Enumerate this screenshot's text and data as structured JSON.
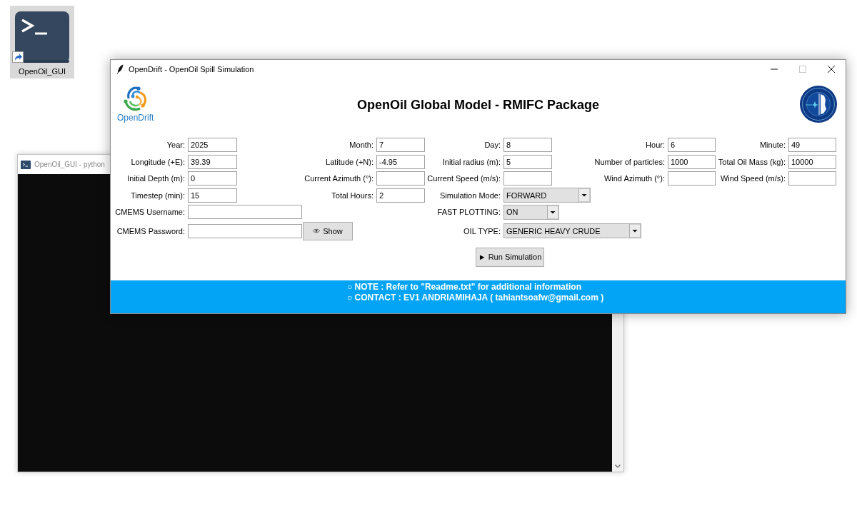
{
  "desktop": {
    "icons": [
      {
        "label": "OpenOil_GUI",
        "selected": true
      }
    ]
  },
  "console_window": {
    "title": "OpenOil_GUI - python",
    "active": false
  },
  "main_window": {
    "title": "OpenDrift - OpenOil Spill Simulation",
    "active": true,
    "controls": [
      {
        "kind": "minimize",
        "disabled": false
      },
      {
        "kind": "maximize",
        "disabled": true
      },
      {
        "kind": "close",
        "disabled": false
      }
    ],
    "header": {
      "logo_text": "OpenDrift",
      "heading": "OpenOil Global Model - RMIFC Package"
    },
    "form": {
      "rows": [
        {
          "fields": [
            {
              "kind": "entry",
              "label": "Year:",
              "value": "2025"
            },
            {
              "kind": "entry",
              "label": "Month:",
              "value": "7"
            },
            {
              "kind": "entry",
              "label": "Day:",
              "value": "8"
            },
            {
              "kind": "entry",
              "label": "Hour:",
              "value": "6"
            },
            {
              "kind": "entry",
              "label": "Minute:",
              "value": "49"
            }
          ]
        },
        {
          "fields": [
            {
              "kind": "entry",
              "label": "Longitude (+E):",
              "value": "39.39"
            },
            {
              "kind": "entry",
              "label": "Latitude (+N):",
              "value": "-4.95"
            },
            {
              "kind": "entry",
              "label": "Initial radius (m):",
              "value": "5"
            },
            {
              "kind": "entry",
              "label": "Number of particles:",
              "value": "1000"
            },
            {
              "kind": "entry",
              "label": "Total Oil Mass (kg):",
              "value": "10000"
            }
          ]
        },
        {
          "fields": [
            {
              "kind": "entry",
              "label": "Initial Depth (m):",
              "value": "0"
            },
            {
              "kind": "entry",
              "label": "Current Azimuth (°):"
            },
            {
              "kind": "entry",
              "label": "Current Speed (m/s):"
            },
            {
              "kind": "entry",
              "label": "Wind Azimuth (°):"
            },
            {
              "kind": "entry",
              "label": "Wind Speed (m/s):"
            }
          ]
        },
        {
          "fields": [
            {
              "kind": "entry",
              "label": "Timestep (min):",
              "value": "15"
            },
            {
              "kind": "entry",
              "label": "Total Hours:",
              "value": "2"
            },
            {
              "kind": "combo",
              "label": "Simulation Mode:",
              "value": "FORWARD"
            }
          ]
        }
      ],
      "credentials": [
        {
          "label": "CMEMS Username:"
        },
        {
          "label": "CMEMS Password:",
          "button": "Show"
        }
      ],
      "options": [
        {
          "label": "FAST PLOTTING:",
          "value": "ON"
        },
        {
          "label": "OIL TYPE:",
          "value": "GENERIC HEAVY CRUDE"
        }
      ],
      "run_button": "► Run Simulation"
    },
    "footer": {
      "lines": [
        "○ NOTE : Refer to \"Readme.txt\" for additional information",
        "○ CONTACT : EV1 ANDRIAMIHAJA ( tahiantsoafw@gmail.com )"
      ]
    }
  }
}
